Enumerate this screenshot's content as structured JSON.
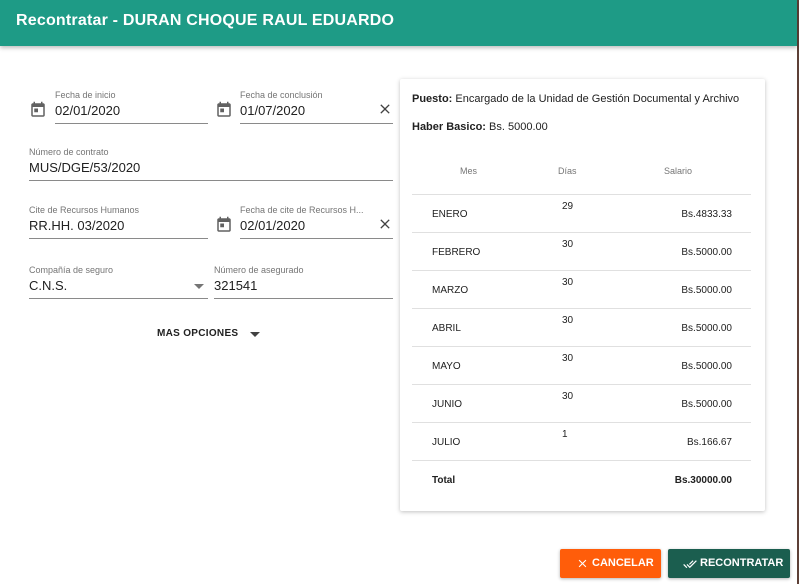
{
  "dialog": {
    "title": "Recontratar - DURAN CHOQUE RAUL EDUARDO"
  },
  "form": {
    "fecha_inicio": {
      "label": "Fecha de inicio",
      "value": "02/01/2020"
    },
    "fecha_conclusion": {
      "label": "Fecha de conclusión",
      "value": "01/07/2020"
    },
    "numero_contrato": {
      "label": "Número de contrato",
      "value": "MUS/DGE/53/2020"
    },
    "cite_rrhh": {
      "label": "Cite de Recursos Humanos",
      "value": "RR.HH. 03/2020"
    },
    "fecha_cite_rrhh": {
      "label": "Fecha de cite de Recursos H...",
      "value": "02/01/2020"
    },
    "compania_seguro": {
      "label": "Compañía de seguro",
      "value": "C.N.S."
    },
    "numero_asegurado": {
      "label": "Número de asegurado",
      "value": "321541"
    },
    "mas_opciones": "MAS OPCIONES"
  },
  "summary": {
    "puesto_label": "Puesto:",
    "puesto_value": "Encargado de la Unidad de Gestión Documental y Archivo",
    "haber_label": "Haber Basico:",
    "haber_value": "Bs. 5000.00",
    "columns": [
      "Mes",
      "Días",
      "Salario"
    ],
    "rows": [
      {
        "mes": "ENERO",
        "dias": "29",
        "salario": "Bs.4833.33"
      },
      {
        "mes": "FEBRERO",
        "dias": "30",
        "salario": "Bs.5000.00"
      },
      {
        "mes": "MARZO",
        "dias": "30",
        "salario": "Bs.5000.00"
      },
      {
        "mes": "ABRIL",
        "dias": "30",
        "salario": "Bs.5000.00"
      },
      {
        "mes": "MAYO",
        "dias": "30",
        "salario": "Bs.5000.00"
      },
      {
        "mes": "JUNIO",
        "dias": "30",
        "salario": "Bs.5000.00"
      },
      {
        "mes": "JULIO",
        "dias": "1",
        "salario": "Bs.166.67"
      }
    ],
    "total_label": "Total",
    "total_value": "Bs.30000.00"
  },
  "actions": {
    "cancel": "CANCELAR",
    "confirm": "RECONTRATAR"
  },
  "colors": {
    "header": "#1e9b86",
    "cancel": "#ff5d0a",
    "confirm": "#1b5e4f"
  },
  "icons": [
    "calendar-icon",
    "clear-icon",
    "dropdown-arrow-icon",
    "close-icon",
    "double-check-icon"
  ]
}
